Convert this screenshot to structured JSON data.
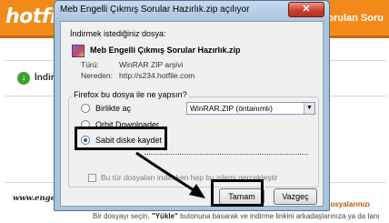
{
  "site": {
    "logo": "hotfi",
    "nav_item": "Sık Sorulan Soru",
    "download_title": "İndir",
    "watermark": "www.engebayram.com.tr",
    "right_text": "bk dosyalarınızı",
    "bottom_prefix": "Bir dosyayı seçin, ",
    "bottom_bold": "\"Yükle\"",
    "bottom_suffix": " butonuna basarak ve indirme linkini arkadaşlarınıza ya da tanı"
  },
  "dialog": {
    "title": "Meb Engelli Çıkmış Sorular Hazırlık.zip açılıyor",
    "close_label": "✕",
    "heading": "İndirmek istediğiniz dosya:",
    "file_name": "Meb Engelli Çıkmış Sorular Hazırlık.zip",
    "type_label": "Türü:",
    "type_value": "WinRAR ZIP arşivi",
    "source_label": "Nereden:",
    "source_value": "http://s234.hotfile.com",
    "question": "Firefox bu dosya ile ne yapsın?",
    "options": [
      {
        "label": "Birlikte aç",
        "checked": false
      },
      {
        "label": "Orbit Downloader",
        "checked": false
      },
      {
        "label": "Sabit diske kaydet",
        "checked": true
      }
    ],
    "open_with_value": "WinRAR.ZIP (öntanımlı)",
    "remember_label": "Bu tür dosyaları indirirken hep bu işlemi gerçekleştir",
    "ok_label": "Tamam",
    "cancel_label": "Vazgeç"
  }
}
